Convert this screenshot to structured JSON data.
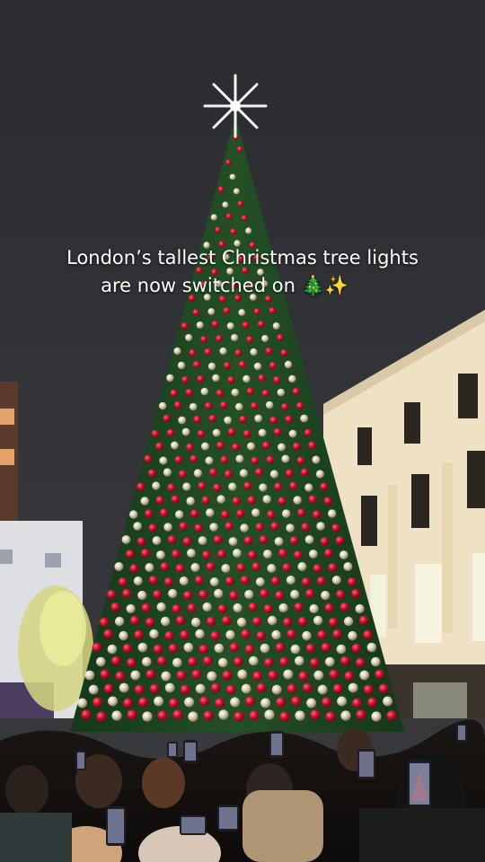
{
  "caption": {
    "line1": "London’s tallest Christmas tree lights",
    "line2": "are now switched on 🎄✨"
  },
  "colors": {
    "sky": "#2c2e31",
    "tree_green": "#1f4a1c",
    "bauble_red": "#c8102e",
    "bauble_gold": "#d8cfb0",
    "building": "#efe2c4",
    "caption_text": "#ffffff"
  }
}
